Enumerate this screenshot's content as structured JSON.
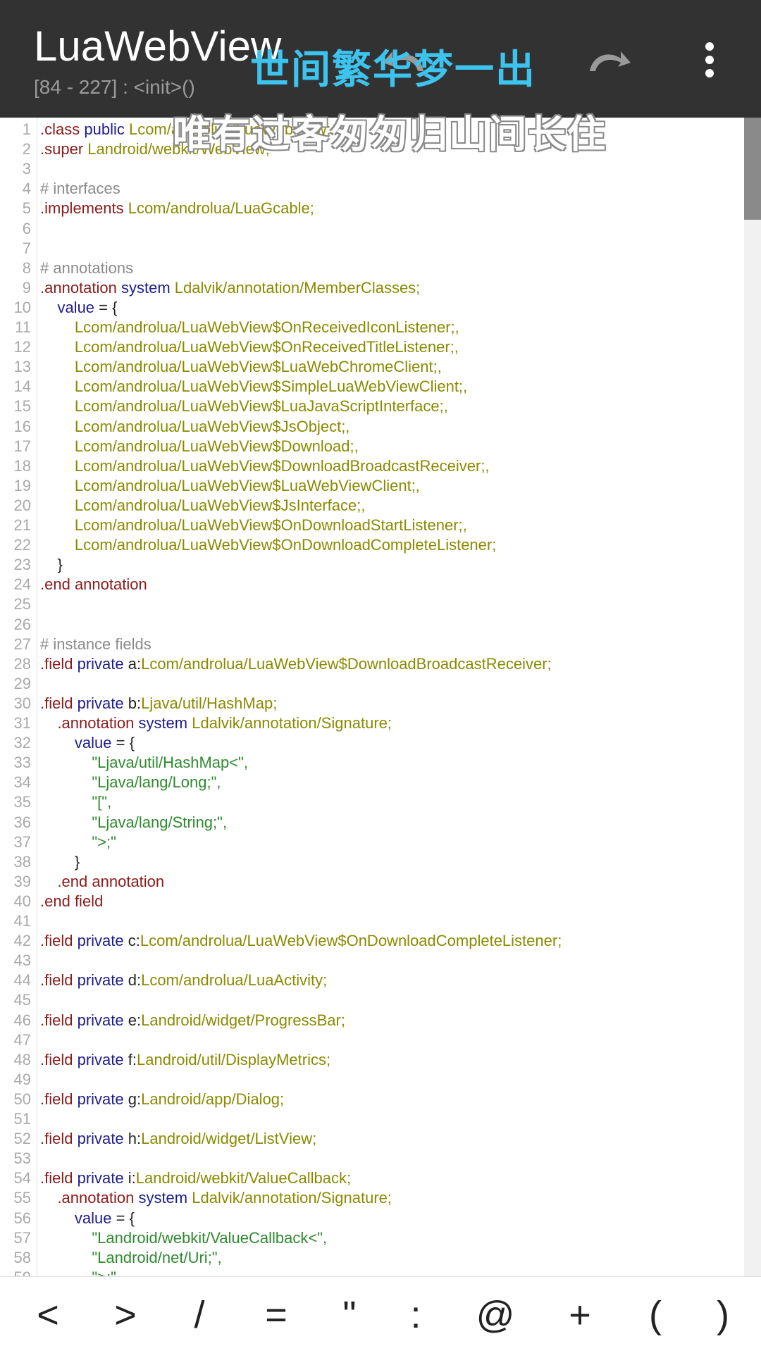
{
  "app": {
    "title": "LuaWebView",
    "subtitle": "[84 - 227] : <init>()"
  },
  "toolbar": {
    "undo_icon": "undo-icon",
    "redo_icon": "redo-icon",
    "more_icon": "more-vert-icon"
  },
  "overlay": {
    "line1": "世间繁华梦一出",
    "line2": "唯有过客匆匆归山间长住"
  },
  "colors": {
    "appbar": "#323232",
    "keyword": "#8b1a1a",
    "modifier": "#1c1c8c",
    "type": "#8a8a00",
    "string": "#2f8a2f",
    "comment": "#8a8a8a",
    "overlay_blue": "#3cc4ef"
  },
  "code": [
    {
      "n": "1",
      "tokens": [
        {
          "t": ".class",
          "c": "kw"
        },
        {
          "t": " public",
          "c": "mod"
        },
        {
          "t": " Lcom/androlua/LuaWebView;",
          "c": "type"
        }
      ]
    },
    {
      "n": "2",
      "tokens": [
        {
          "t": ".super",
          "c": "kw"
        },
        {
          "t": " Landroid/webkit/WebView;",
          "c": "type"
        }
      ]
    },
    {
      "n": "3",
      "tokens": []
    },
    {
      "n": "4",
      "tokens": [
        {
          "t": "# interfaces",
          "c": "cm"
        }
      ]
    },
    {
      "n": "5",
      "tokens": [
        {
          "t": ".implements",
          "c": "kw"
        },
        {
          "t": " Lcom/androlua/LuaGcable;",
          "c": "type"
        }
      ]
    },
    {
      "n": "6",
      "tokens": []
    },
    {
      "n": "7",
      "tokens": []
    },
    {
      "n": "8",
      "tokens": [
        {
          "t": "# annotations",
          "c": "cm"
        }
      ]
    },
    {
      "n": "9",
      "tokens": [
        {
          "t": ".annotation",
          "c": "kw"
        },
        {
          "t": " system",
          "c": "mod"
        },
        {
          "t": " Ldalvik/annotation/MemberClasses;",
          "c": "type"
        }
      ]
    },
    {
      "n": "10",
      "tokens": [
        {
          "t": "    value",
          "c": "mod"
        },
        {
          "t": " = {",
          "c": "plain"
        }
      ]
    },
    {
      "n": "11",
      "tokens": [
        {
          "t": "        Lcom/androlua/LuaWebView$OnReceivedIconListener;,",
          "c": "type"
        }
      ]
    },
    {
      "n": "12",
      "tokens": [
        {
          "t": "        Lcom/androlua/LuaWebView$OnReceivedTitleListener;,",
          "c": "type"
        }
      ]
    },
    {
      "n": "13",
      "tokens": [
        {
          "t": "        Lcom/androlua/LuaWebView$LuaWebChromeClient;,",
          "c": "type"
        }
      ]
    },
    {
      "n": "14",
      "tokens": [
        {
          "t": "        Lcom/androlua/LuaWebView$SimpleLuaWebViewClient;,",
          "c": "type"
        }
      ]
    },
    {
      "n": "15",
      "tokens": [
        {
          "t": "        Lcom/androlua/LuaWebView$LuaJavaScriptInterface;,",
          "c": "type"
        }
      ]
    },
    {
      "n": "16",
      "tokens": [
        {
          "t": "        Lcom/androlua/LuaWebView$JsObject;,",
          "c": "type"
        }
      ]
    },
    {
      "n": "17",
      "tokens": [
        {
          "t": "        Lcom/androlua/LuaWebView$Download;,",
          "c": "type"
        }
      ]
    },
    {
      "n": "18",
      "tokens": [
        {
          "t": "        Lcom/androlua/LuaWebView$DownloadBroadcastReceiver;,",
          "c": "type"
        }
      ]
    },
    {
      "n": "19",
      "tokens": [
        {
          "t": "        Lcom/androlua/LuaWebView$LuaWebViewClient;,",
          "c": "type"
        }
      ]
    },
    {
      "n": "20",
      "tokens": [
        {
          "t": "        Lcom/androlua/LuaWebView$JsInterface;,",
          "c": "type"
        }
      ]
    },
    {
      "n": "21",
      "tokens": [
        {
          "t": "        Lcom/androlua/LuaWebView$OnDownloadStartListener;,",
          "c": "type"
        }
      ]
    },
    {
      "n": "22",
      "tokens": [
        {
          "t": "        Lcom/androlua/LuaWebView$OnDownloadCompleteListener;",
          "c": "type"
        }
      ]
    },
    {
      "n": "23",
      "tokens": [
        {
          "t": "    }",
          "c": "plain"
        }
      ]
    },
    {
      "n": "24",
      "tokens": [
        {
          "t": ".end",
          "c": "kw"
        },
        {
          "t": " annotation",
          "c": "kw"
        }
      ]
    },
    {
      "n": "25",
      "tokens": []
    },
    {
      "n": "26",
      "tokens": []
    },
    {
      "n": "27",
      "tokens": [
        {
          "t": "# instance fields",
          "c": "cm"
        }
      ]
    },
    {
      "n": "28",
      "tokens": [
        {
          "t": ".field",
          "c": "kw"
        },
        {
          "t": " private",
          "c": "mod"
        },
        {
          "t": " a:",
          "c": "plain"
        },
        {
          "t": "Lcom/androlua/LuaWebView$DownloadBroadcastReceiver;",
          "c": "type"
        }
      ]
    },
    {
      "n": "29",
      "tokens": []
    },
    {
      "n": "30",
      "tokens": [
        {
          "t": ".field",
          "c": "kw"
        },
        {
          "t": " private",
          "c": "mod"
        },
        {
          "t": " b:",
          "c": "plain"
        },
        {
          "t": "Ljava/util/HashMap;",
          "c": "type"
        }
      ]
    },
    {
      "n": "31",
      "tokens": [
        {
          "t": "    .annotation",
          "c": "kw"
        },
        {
          "t": " system",
          "c": "mod"
        },
        {
          "t": " Ldalvik/annotation/Signature;",
          "c": "type"
        }
      ]
    },
    {
      "n": "32",
      "tokens": [
        {
          "t": "        value",
          "c": "mod"
        },
        {
          "t": " = {",
          "c": "plain"
        }
      ]
    },
    {
      "n": "33",
      "tokens": [
        {
          "t": "            \"Ljava/util/HashMap<\",",
          "c": "str"
        }
      ]
    },
    {
      "n": "34",
      "tokens": [
        {
          "t": "            \"Ljava/lang/Long;\",",
          "c": "str"
        }
      ]
    },
    {
      "n": "35",
      "tokens": [
        {
          "t": "            \"[\",",
          "c": "str"
        }
      ]
    },
    {
      "n": "36",
      "tokens": [
        {
          "t": "            \"Ljava/lang/String;\",",
          "c": "str"
        }
      ]
    },
    {
      "n": "37",
      "tokens": [
        {
          "t": "            \">;\"",
          "c": "str"
        }
      ]
    },
    {
      "n": "38",
      "tokens": [
        {
          "t": "        }",
          "c": "plain"
        }
      ]
    },
    {
      "n": "39",
      "tokens": [
        {
          "t": "    .end",
          "c": "kw"
        },
        {
          "t": " annotation",
          "c": "kw"
        }
      ]
    },
    {
      "n": "40",
      "tokens": [
        {
          "t": ".end",
          "c": "kw"
        },
        {
          "t": " field",
          "c": "kw"
        }
      ]
    },
    {
      "n": "41",
      "tokens": []
    },
    {
      "n": "42",
      "tokens": [
        {
          "t": ".field",
          "c": "kw"
        },
        {
          "t": " private",
          "c": "mod"
        },
        {
          "t": " c:",
          "c": "plain"
        },
        {
          "t": "Lcom/androlua/LuaWebView$OnDownloadCompleteListener;",
          "c": "type"
        }
      ]
    },
    {
      "n": "43",
      "tokens": []
    },
    {
      "n": "44",
      "tokens": [
        {
          "t": ".field",
          "c": "kw"
        },
        {
          "t": " private",
          "c": "mod"
        },
        {
          "t": " d:",
          "c": "plain"
        },
        {
          "t": "Lcom/androlua/LuaActivity;",
          "c": "type"
        }
      ]
    },
    {
      "n": "45",
      "tokens": []
    },
    {
      "n": "46",
      "tokens": [
        {
          "t": ".field",
          "c": "kw"
        },
        {
          "t": " private",
          "c": "mod"
        },
        {
          "t": " e:",
          "c": "plain"
        },
        {
          "t": "Landroid/widget/ProgressBar;",
          "c": "type"
        }
      ]
    },
    {
      "n": "47",
      "tokens": []
    },
    {
      "n": "48",
      "tokens": [
        {
          "t": ".field",
          "c": "kw"
        },
        {
          "t": " private",
          "c": "mod"
        },
        {
          "t": " f:",
          "c": "plain"
        },
        {
          "t": "Landroid/util/DisplayMetrics;",
          "c": "type"
        }
      ]
    },
    {
      "n": "49",
      "tokens": []
    },
    {
      "n": "50",
      "tokens": [
        {
          "t": ".field",
          "c": "kw"
        },
        {
          "t": " private",
          "c": "mod"
        },
        {
          "t": " g:",
          "c": "plain"
        },
        {
          "t": "Landroid/app/Dialog;",
          "c": "type"
        }
      ]
    },
    {
      "n": "51",
      "tokens": []
    },
    {
      "n": "52",
      "tokens": [
        {
          "t": ".field",
          "c": "kw"
        },
        {
          "t": " private",
          "c": "mod"
        },
        {
          "t": " h:",
          "c": "plain"
        },
        {
          "t": "Landroid/widget/ListView;",
          "c": "type"
        }
      ]
    },
    {
      "n": "53",
      "tokens": []
    },
    {
      "n": "54",
      "tokens": [
        {
          "t": ".field",
          "c": "kw"
        },
        {
          "t": " private",
          "c": "mod"
        },
        {
          "t": " i:",
          "c": "plain"
        },
        {
          "t": "Landroid/webkit/ValueCallback;",
          "c": "type"
        }
      ]
    },
    {
      "n": "55",
      "tokens": [
        {
          "t": "    .annotation",
          "c": "kw"
        },
        {
          "t": " system",
          "c": "mod"
        },
        {
          "t": " Ldalvik/annotation/Signature;",
          "c": "type"
        }
      ]
    },
    {
      "n": "56",
      "tokens": [
        {
          "t": "        value",
          "c": "mod"
        },
        {
          "t": " = {",
          "c": "plain"
        }
      ]
    },
    {
      "n": "57",
      "tokens": [
        {
          "t": "            \"Landroid/webkit/ValueCallback<\",",
          "c": "str"
        }
      ]
    },
    {
      "n": "58",
      "tokens": [
        {
          "t": "            \"Landroid/net/Uri;\",",
          "c": "str"
        }
      ]
    },
    {
      "n": "59",
      "tokens": [
        {
          "t": "            \">;\"",
          "c": "str"
        }
      ]
    }
  ],
  "keybar": {
    "keys": [
      "<",
      ">",
      "/",
      "=",
      "\"",
      ":",
      "@",
      "+",
      "(",
      ")"
    ]
  }
}
